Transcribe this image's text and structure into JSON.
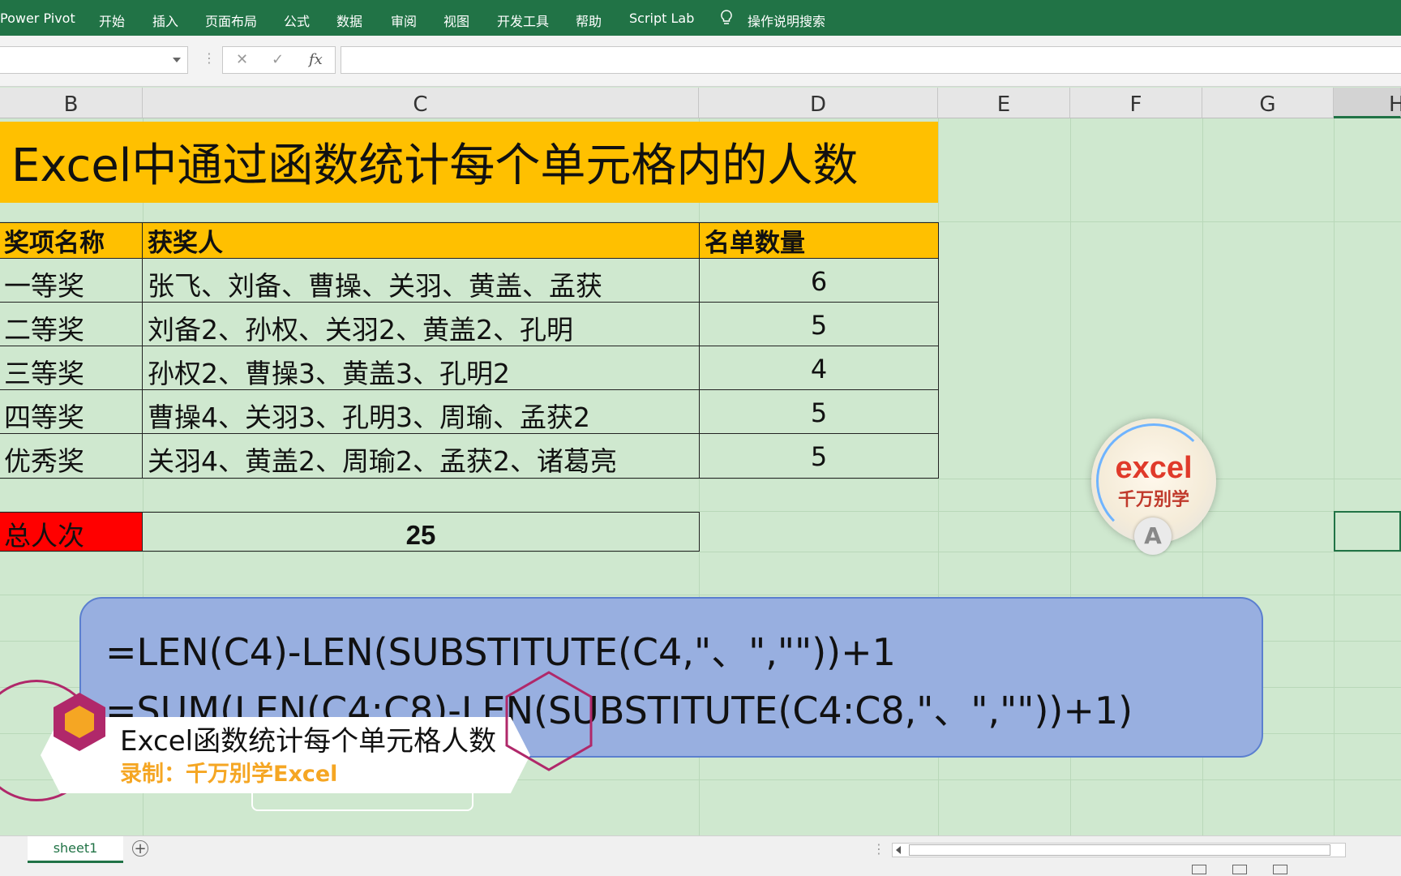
{
  "ribbon": {
    "tabs": [
      "Power Pivot",
      "开始",
      "插入",
      "页面布局",
      "公式",
      "数据",
      "审阅",
      "视图",
      "开发工具",
      "帮助",
      "Script Lab"
    ],
    "search_label": "操作说明搜索"
  },
  "formula_bar": {
    "name_box": "",
    "cancel": "✕",
    "confirm": "✓",
    "fx": "fx",
    "content": ""
  },
  "columns": [
    "B",
    "C",
    "D",
    "E",
    "F",
    "G",
    "H"
  ],
  "sheet": {
    "title": "Excel中通过函数统计每个单元格内的人数",
    "headers": [
      "奖项名称",
      "获奖人",
      "名单数量"
    ],
    "rows": [
      {
        "award": "一等奖",
        "winners": "张飞、刘备、曹操、关羽、黄盖、孟获",
        "count": "6"
      },
      {
        "award": "二等奖",
        "winners": "刘备2、孙权、关羽2、黄盖2、孔明",
        "count": "5"
      },
      {
        "award": "三等奖",
        "winners": "孙权2、曹操3、黄盖3、孔明2",
        "count": "4"
      },
      {
        "award": "四等奖",
        "winners": "曹操4、关羽3、孔明3、周瑜、孟获2",
        "count": "5"
      },
      {
        "award": "优秀奖",
        "winners": "关羽4、黄盖2、周瑜2、孟获2、诸葛亮",
        "count": "5"
      }
    ],
    "total_label": "总人次",
    "total_value": "25"
  },
  "formulas": {
    "line1": "=LEN(C4)-LEN(SUBSTITUTE(C4,\"、\",\"\"))+1",
    "line2": "=SUM(LEN(C4:C8)-LEN(SUBSTITUTE(C4:C8,\"、\",\"\"))+1)"
  },
  "logo": {
    "word": "excel",
    "subtitle": "千万别学",
    "badge_letter": "A"
  },
  "caption": {
    "title": "Excel函数统计每个单元格人数",
    "subtitle": "录制：千万别学Excel"
  },
  "sheet_tabs": [
    {
      "name": "sheet1"
    }
  ],
  "add_sheet": "+",
  "colors": {
    "ribbon": "#217346",
    "banner": "#ffc000",
    "total_label_bg": "#ff0000",
    "formula_box": "#98afe0",
    "cell_bg": "#cfe8cf"
  }
}
